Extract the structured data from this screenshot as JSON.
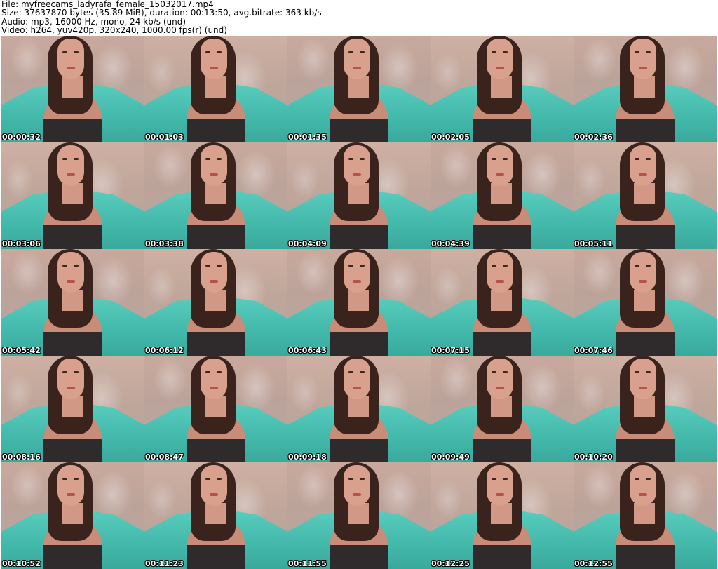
{
  "header": {
    "file": "File: myfreecams_ladyrafa_female_15032017.mp4",
    "size": "Size: 37637870 bytes (35.89 MiB), duration: 00:13:50, avg.bitrate: 363 kb/s",
    "audio": "Audio: mp3, 16000 Hz, mono, 24 kb/s (und)",
    "video": "Video: h264, yuv420p, 320x240, 1000.00 fps(r) (und)"
  },
  "timestamps": [
    "00:00:32",
    "00:01:03",
    "00:01:35",
    "00:02:05",
    "00:02:36",
    "00:03:06",
    "00:03:38",
    "00:04:09",
    "00:04:39",
    "00:05:11",
    "00:05:42",
    "00:06:12",
    "00:06:43",
    "00:07:15",
    "00:07:46",
    "00:08:16",
    "00:08:47",
    "00:09:18",
    "00:09:49",
    "00:10:20",
    "00:10:52",
    "00:11:23",
    "00:11:55",
    "00:12:25",
    "00:12:55"
  ]
}
